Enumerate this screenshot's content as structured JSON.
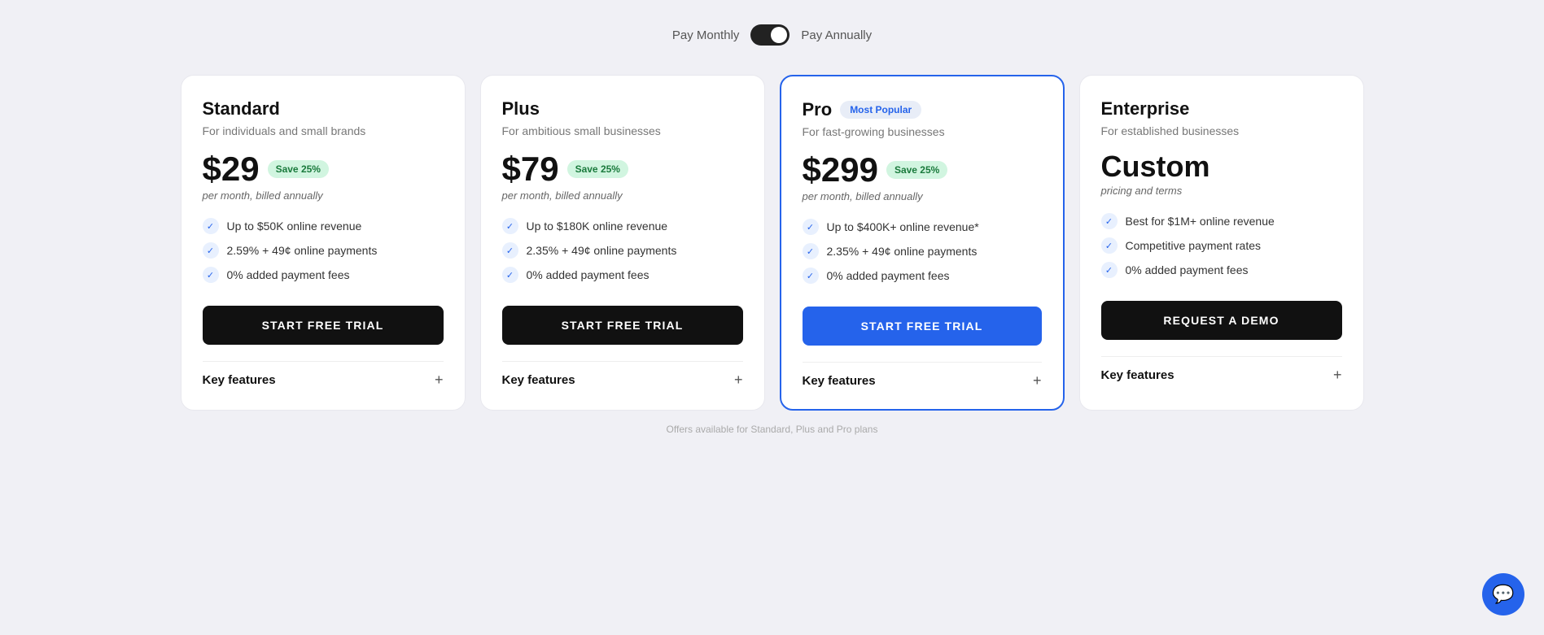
{
  "billing": {
    "label_monthly": "Pay Monthly",
    "label_annually": "Pay Annually",
    "toggle_state": "annually"
  },
  "plans": [
    {
      "id": "standard",
      "name": "Standard",
      "description": "For individuals and small brands",
      "price": "$29",
      "save_badge": "Save 25%",
      "period": "per month, billed annually",
      "highlighted": false,
      "most_popular": false,
      "features": [
        "Up to $50K online revenue",
        "2.59% + 49¢ online payments",
        "0% added payment fees"
      ],
      "cta_label": "START FREE TRIAL",
      "cta_style": "dark",
      "key_features_label": "Key features",
      "key_features_icon": "+"
    },
    {
      "id": "plus",
      "name": "Plus",
      "description": "For ambitious small businesses",
      "price": "$79",
      "save_badge": "Save 25%",
      "period": "per month, billed annually",
      "highlighted": false,
      "most_popular": false,
      "features": [
        "Up to $180K online revenue",
        "2.35% + 49¢ online payments",
        "0% added payment fees"
      ],
      "cta_label": "START FREE TRIAL",
      "cta_style": "dark",
      "key_features_label": "Key features",
      "key_features_icon": "+"
    },
    {
      "id": "pro",
      "name": "Pro",
      "description": "For fast-growing businesses",
      "price": "$299",
      "save_badge": "Save 25%",
      "period": "per month, billed annually",
      "highlighted": true,
      "most_popular": true,
      "most_popular_label": "Most Popular",
      "features": [
        "Up to $400K+ online revenue*",
        "2.35% + 49¢ online payments",
        "0% added payment fees"
      ],
      "cta_label": "START FREE TRIAL",
      "cta_style": "blue",
      "key_features_label": "Key features",
      "key_features_icon": "+"
    },
    {
      "id": "enterprise",
      "name": "Enterprise",
      "description": "For established businesses",
      "price": "Custom",
      "price_is_custom": true,
      "period": "pricing and terms",
      "highlighted": false,
      "most_popular": false,
      "features": [
        "Best for $1M+ online revenue",
        "Competitive payment rates",
        "0% added payment fees"
      ],
      "cta_label": "REQUEST A DEMO",
      "cta_style": "dark",
      "key_features_label": "Key features",
      "key_features_icon": "+"
    }
  ],
  "bottom_note": "Offers available for Standard, Plus and Pro plans",
  "chat_icon": "💬"
}
